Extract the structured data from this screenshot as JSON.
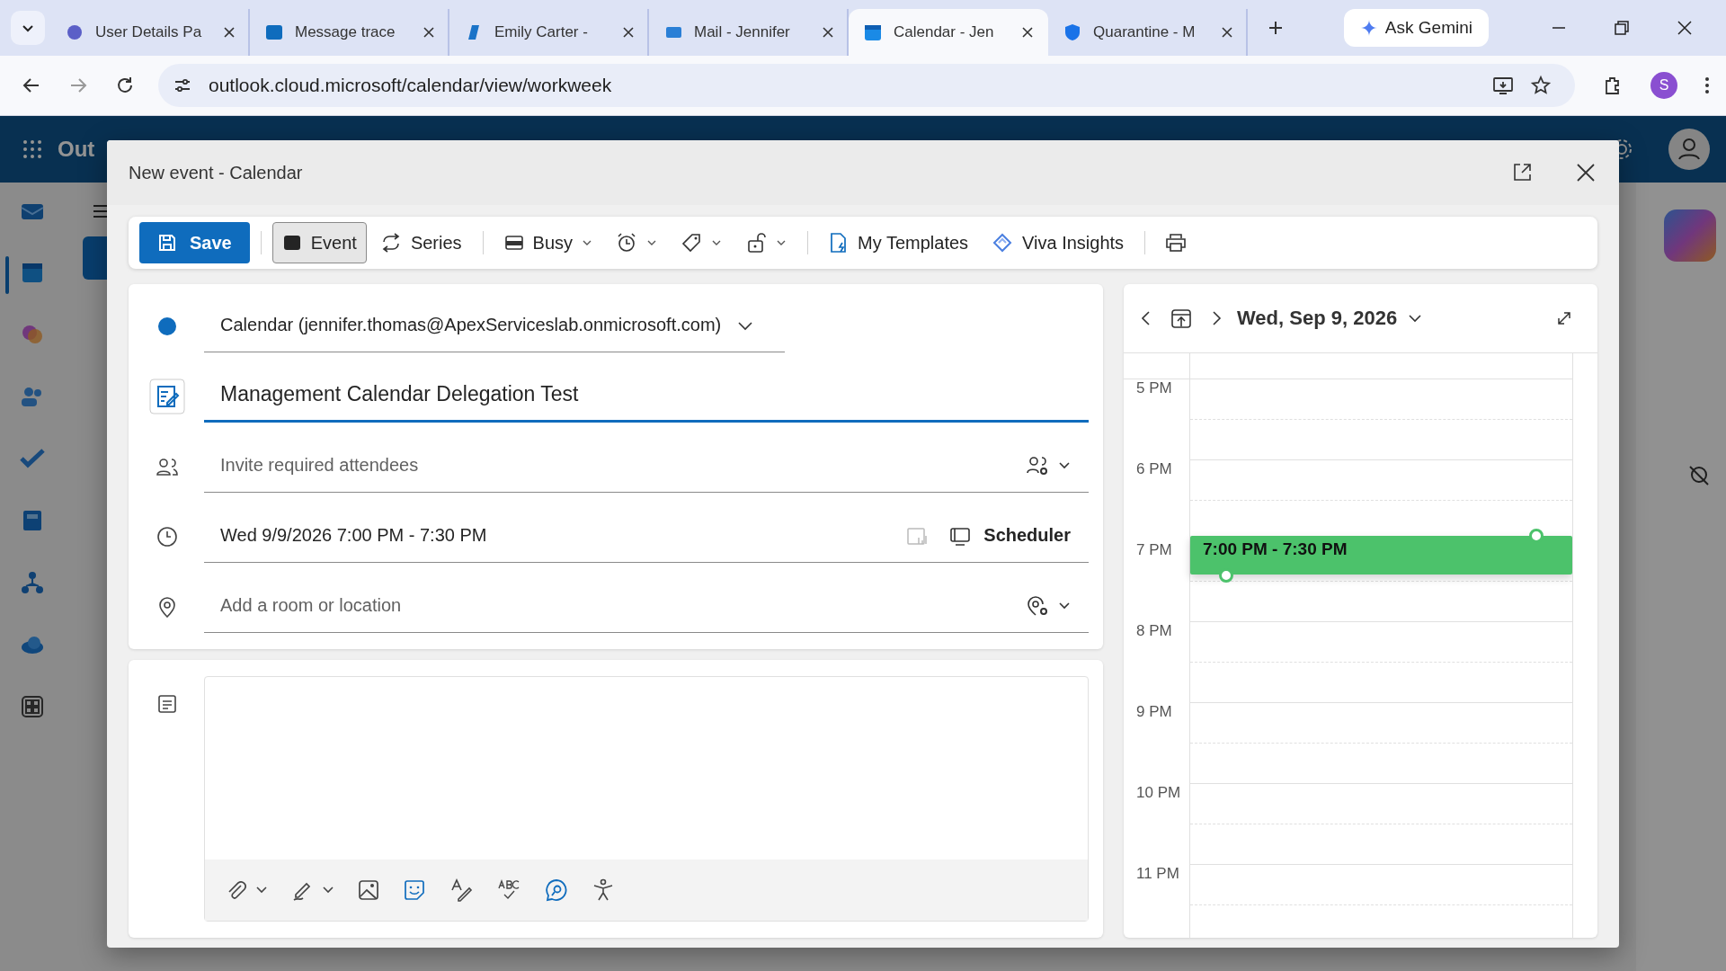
{
  "browser": {
    "tabs": [
      {
        "title": "User Details Pa",
        "selected": false
      },
      {
        "title": "Message trace",
        "selected": false
      },
      {
        "title": "Emily Carter -",
        "selected": false
      },
      {
        "title": "Mail - Jennifer",
        "selected": false
      },
      {
        "title": "Calendar - Jen",
        "selected": true
      },
      {
        "title": "Quarantine - M",
        "selected": false
      }
    ],
    "gemini": "Ask Gemini",
    "url": "outlook.cloud.microsoft/calendar/view/workweek",
    "profile": "S"
  },
  "app": {
    "title": "Out"
  },
  "dialog": {
    "title": "New event - Calendar",
    "toolbar": {
      "save": "Save",
      "event": {
        "label": "Event",
        "selected": true
      },
      "series": "Series",
      "busy": "Busy",
      "templates": "My Templates",
      "insights": "Viva Insights"
    },
    "form": {
      "calendar": {
        "label": "Calendar (jennifer.thomas@ApexServiceslab.onmicrosoft.com)",
        "color": "#0f6cbd"
      },
      "title": {
        "value": "Management Calendar Delegation Test"
      },
      "attendees": {
        "placeholder": "Invite required attendees"
      },
      "time": {
        "value": "Wed 9/9/2026 7:00 PM - 7:30 PM",
        "scheduler": "Scheduler"
      },
      "location": {
        "placeholder": "Add a room or location"
      }
    },
    "day_view": {
      "date": "Wed, Sep 9, 2026",
      "hours": [
        {
          "label": "5 PM"
        },
        {
          "label": "6 PM"
        },
        {
          "label": "7 PM",
          "event": {
            "time": "7:00 PM - 7:30 PM",
            "color": "#4cc26b"
          }
        },
        {
          "label": "8 PM"
        },
        {
          "label": "9 PM"
        },
        {
          "label": "10 PM"
        },
        {
          "label": "11 PM"
        }
      ]
    }
  }
}
